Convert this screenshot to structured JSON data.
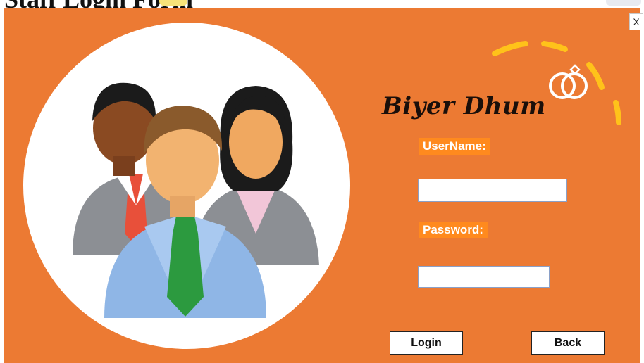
{
  "window": {
    "close_label": "X"
  },
  "header_cutoff": {
    "partial_title": "Staff Login Form"
  },
  "brand": {
    "name": "Biyer Dhum",
    "accent_dashes": "#ffc21a",
    "ring_color": "#ffffff"
  },
  "form": {
    "username_label": "UserName:",
    "username_value": "",
    "password_label": "Password:",
    "password_value": ""
  },
  "buttons": {
    "login": "Login",
    "back": "Back"
  },
  "colors": {
    "panel": "#ec7a33",
    "label_bg": "#ff8a1e"
  },
  "illustration": {
    "icon": "users-group-icon"
  }
}
